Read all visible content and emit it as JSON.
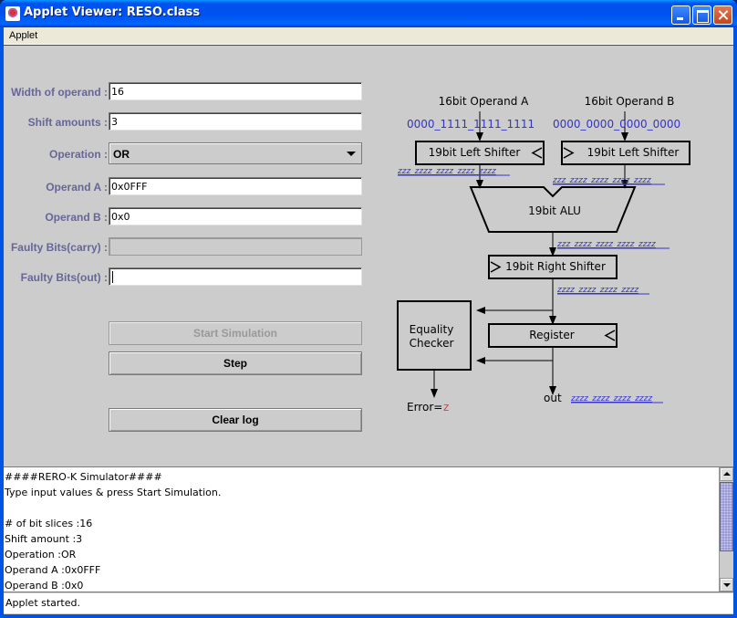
{
  "window": {
    "title": "Applet Viewer: RESO.class",
    "menu": [
      "Applet"
    ]
  },
  "form": {
    "width_label": "Width of operand :",
    "width_value": "16",
    "shift_label": "Shift amounts :",
    "shift_value": "3",
    "operation_label": "Operation :",
    "operation_value": "OR",
    "operand_a_label": "Operand A :",
    "operand_a_value": "0x0FFF",
    "operand_b_label": "Operand B :",
    "operand_b_value": "0x0",
    "faulty_carry_label": "Faulty Bits(carry) :",
    "faulty_carry_value": "",
    "faulty_out_label": "Faulty Bits(out) :",
    "faulty_out_value": ""
  },
  "buttons": {
    "start": "Start Simulation",
    "step": "Step",
    "clear": "Clear log"
  },
  "diagram": {
    "operand_a_title": "16bit Operand A",
    "operand_b_title": "16bit Operand B",
    "operand_a_bits": "0000_1111_1111_1111",
    "operand_b_bits": "0000_0000_0000_0000",
    "left_shifter_a": "19bit Left Shifter",
    "left_shifter_b": "19bit Left Shifter",
    "shifter_a_out": "zzz_zzzz_zzzz_zzzz_zzzz",
    "shifter_b_out": "zzz_zzzz_zzzz_zzzz_zzzz",
    "alu": "19bit ALU",
    "alu_out": "zzz_zzzz_zzzz_zzzz_zzzz",
    "right_shifter": "19bit Right Shifter",
    "right_shifter_out": "zzzz_zzzz_zzzz_zzzz",
    "equality_checker_line1": "Equality",
    "equality_checker_line2": "Checker",
    "register": "Register",
    "error_label": "Error=",
    "error_value": "z",
    "out_label": "out",
    "out_value": "zzzz_zzzz_zzzz_zzzz",
    "colors": {
      "bits": "#3333cc",
      "z_value": "#3333cc",
      "error": "#ff0000"
    }
  },
  "log": {
    "lines": [
      "####RERO-K Simulator####",
      "Type input values & press Start Simulation.",
      "",
      "# of bit slices :16",
      "Shift amount :3",
      "Operation :OR",
      "Operand A :0x0FFF",
      "Operand B :0x0"
    ],
    "scroll_position": 0.45
  },
  "status": {
    "text": "Applet started."
  }
}
